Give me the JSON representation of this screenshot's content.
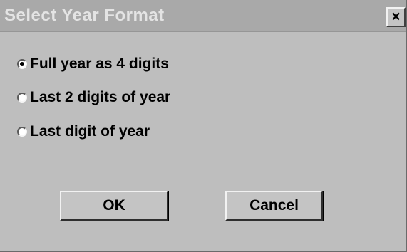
{
  "window": {
    "title": "Select Year Format",
    "close_label": "×"
  },
  "options": [
    {
      "label": "Full year as 4 digits",
      "checked": true
    },
    {
      "label": "Last 2 digits of year",
      "checked": false
    },
    {
      "label": "Last digit of year",
      "checked": false
    }
  ],
  "buttons": {
    "ok_label": "OK",
    "cancel_label": "Cancel"
  }
}
